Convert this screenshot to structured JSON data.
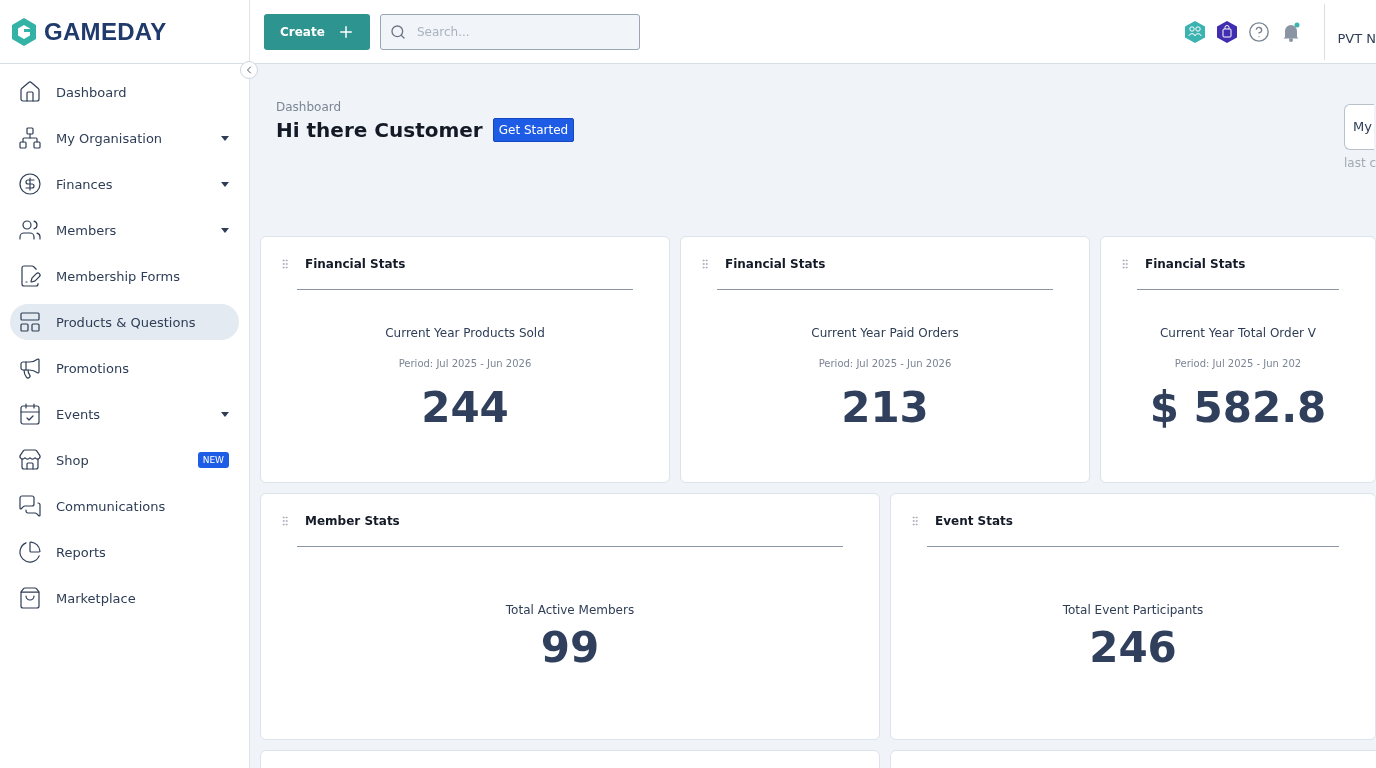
{
  "logo": {
    "text": "GAMEDAY"
  },
  "sidebar": {
    "items": [
      {
        "label": "Dashboard",
        "expandable": false,
        "selected": false
      },
      {
        "label": "My Organisation",
        "expandable": true,
        "selected": false
      },
      {
        "label": "Finances",
        "expandable": true,
        "selected": false
      },
      {
        "label": "Members",
        "expandable": true,
        "selected": false
      },
      {
        "label": "Membership Forms",
        "expandable": false,
        "selected": false
      },
      {
        "label": "Products & Questions",
        "expandable": false,
        "selected": true
      },
      {
        "label": "Promotions",
        "expandable": false,
        "selected": false
      },
      {
        "label": "Events",
        "expandable": true,
        "selected": false
      },
      {
        "label": "Shop",
        "expandable": false,
        "selected": false,
        "badge": "NEW"
      },
      {
        "label": "Communications",
        "expandable": false,
        "selected": false
      },
      {
        "label": "Reports",
        "expandable": false,
        "selected": false
      },
      {
        "label": "Marketplace",
        "expandable": false,
        "selected": false
      }
    ]
  },
  "header": {
    "create_button": "Create",
    "search": {
      "placeholder": "Search..."
    },
    "account": "PVT N"
  },
  "page": {
    "breadcrumb": "Dashboard",
    "title": "Hi there Customer",
    "get_started": "Get Started",
    "selector": "My",
    "selector_note": "last c"
  },
  "stat_rows": [
    [
      {
        "title": "Financial Stats",
        "label": "Current Year Products Sold",
        "period": "Period: Jul 2025 - Jun 2026",
        "value": "244"
      },
      {
        "title": "Financial Stats",
        "label": "Current Year Paid Orders",
        "period": "Period: Jul 2025 - Jun 2026",
        "value": "213"
      },
      {
        "title": "Financial Stats",
        "label": "Current Year Total Order V",
        "period": "Period: Jul 2025 - Jun 202",
        "value": "$ 582.8"
      }
    ],
    [
      {
        "title": "Member Stats",
        "label": "Total Active Members",
        "value": "99"
      },
      {
        "title": "Event Stats",
        "label": "Total Event Participants",
        "value": "246"
      }
    ]
  ]
}
